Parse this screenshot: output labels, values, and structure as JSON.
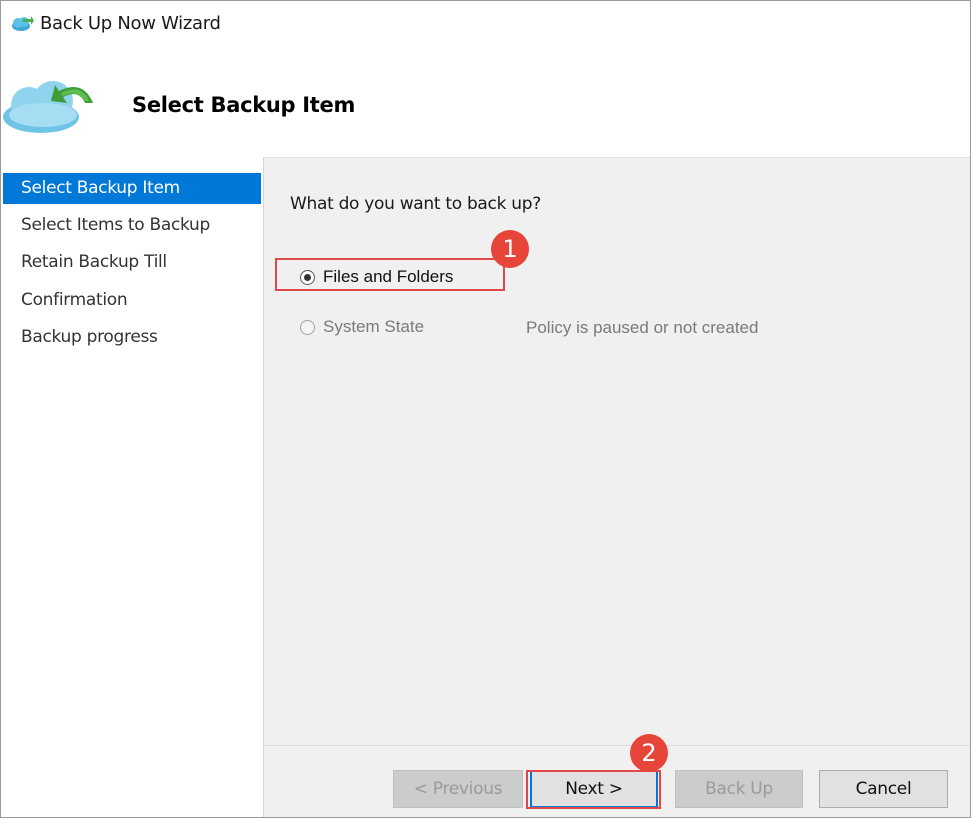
{
  "window": {
    "title": "Back Up Now Wizard"
  },
  "header": {
    "title": "Select Backup Item"
  },
  "sidebar": {
    "items": [
      {
        "label": "Select Backup Item",
        "active": true
      },
      {
        "label": "Select Items to Backup",
        "active": false
      },
      {
        "label": "Retain Backup Till",
        "active": false
      },
      {
        "label": "Confirmation",
        "active": false
      },
      {
        "label": "Backup progress",
        "active": false
      }
    ]
  },
  "main": {
    "question": "What do you want to back up?",
    "options": [
      {
        "label": "Files and Folders",
        "checked": true,
        "enabled": true
      },
      {
        "label": "System State",
        "checked": false,
        "enabled": false
      }
    ],
    "policy_note": "Policy is paused or not created"
  },
  "annotations": {
    "step1": "1",
    "step2": "2",
    "highlight_color": "#e04848"
  },
  "buttons": {
    "previous": "< Previous",
    "next": "Next >",
    "back_up": "Back Up",
    "cancel": "Cancel"
  },
  "colors": {
    "accent": "#0078d7",
    "content_bg": "#f0f0f0",
    "badge": "#e8453a"
  }
}
